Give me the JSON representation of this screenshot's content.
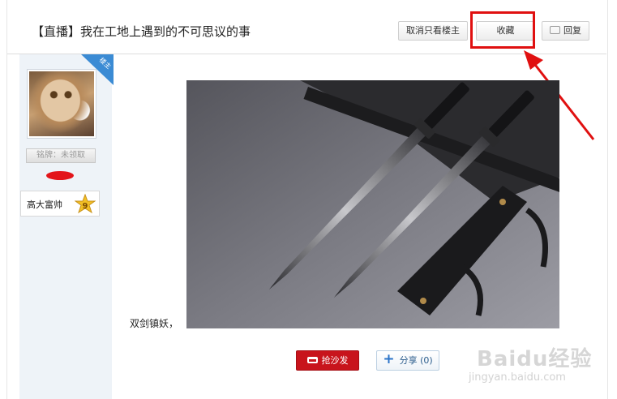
{
  "thread": {
    "title": "【直播】我在工地上遇到的不可思议的事",
    "cancel_only_op_label": "取消只看楼主",
    "favorite_label": "收藏",
    "reply_label": "回复"
  },
  "author": {
    "op_badge": "楼主",
    "medal_label": "铭牌：未领取",
    "level_title": "高大富帅",
    "level": "9"
  },
  "post": {
    "caption": "双剑镇妖，"
  },
  "actions": {
    "sofa_label": "抢沙发",
    "share_label": "分享",
    "share_count": "(0)"
  },
  "watermark": {
    "brand": "Baidu经验",
    "url": "jingyan.baidu.com"
  },
  "colors": {
    "highlight": "#e01010",
    "sofa_button": "#c8141c",
    "share_text": "#2a5c8c",
    "sidebar_bg": "#eef3f8"
  },
  "icons": {
    "reply": "speech-bubble-icon",
    "sofa": "sofa-icon",
    "share": "plus-icon",
    "level": "star-icon",
    "annotation": "red-arrow"
  }
}
